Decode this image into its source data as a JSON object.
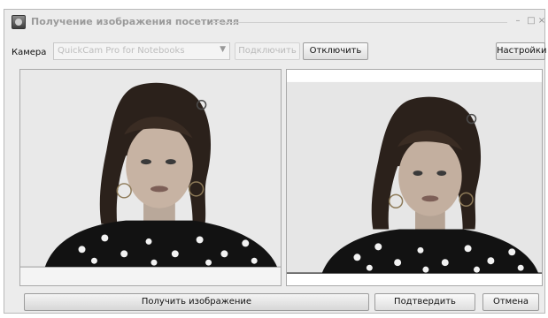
{
  "window": {
    "title": "Получение изображения посетителя",
    "controls": {
      "minimize": "–",
      "maximize": "□",
      "close": "×"
    }
  },
  "toolbar": {
    "camera_label": "Камера",
    "camera_select_value": "QuickCam Pro for Notebooks",
    "connect_label": "Подключить",
    "disconnect_label": "Отключить",
    "settings_label": "Настройки"
  },
  "panels": {
    "live_preview": {
      "icon": "woman-portrait-photo"
    },
    "captured_image": {
      "icon": "woman-portrait-photo"
    }
  },
  "bottom": {
    "capture_label": "Получить изображение",
    "confirm_label": "Подтвердить",
    "cancel_label": "Отмена"
  }
}
